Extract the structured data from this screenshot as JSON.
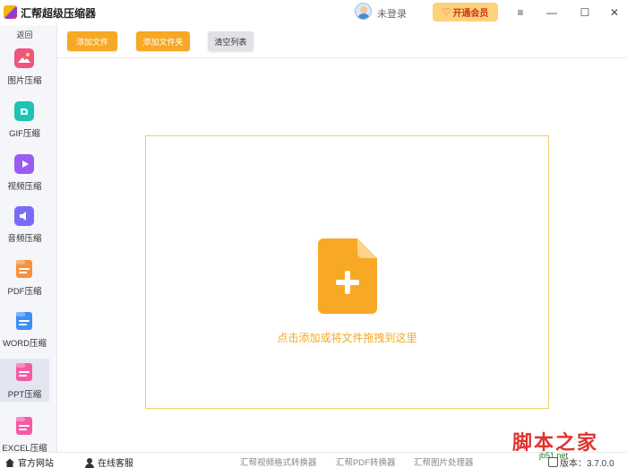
{
  "titlebar": {
    "app_title": "汇帮超级压缩器",
    "login_label": "未登录",
    "vip_label": "开通会员",
    "controls": {
      "menu": "≡",
      "minimize": "—",
      "maximize": "☐",
      "close": "✕"
    }
  },
  "sidebar": {
    "back_label": "返回",
    "items": [
      {
        "label": "图片压缩",
        "icon": "image-icon",
        "color": "#f0557c"
      },
      {
        "label": "GIF压缩",
        "icon": "gif-icon",
        "color": "#1fc3b3"
      },
      {
        "label": "视频压缩",
        "icon": "video-play-icon",
        "color": "#9a5cf2"
      },
      {
        "label": "音频压缩",
        "icon": "audio-icon",
        "color": "#7b6cf6"
      },
      {
        "label": "PDF压缩",
        "icon": "pdf-file-icon",
        "color": "#f7923a"
      },
      {
        "label": "WORD压缩",
        "icon": "word-file-icon",
        "color": "#3d8ef5"
      },
      {
        "label": "PPT压缩",
        "icon": "ppt-file-icon",
        "color": "#f55aa3",
        "active": true
      },
      {
        "label": "EXCEL压缩",
        "icon": "excel-file-icon",
        "color": "#f55aa3"
      }
    ]
  },
  "toolbar": {
    "add_file": "添加文件",
    "add_folder": "添加文件夹",
    "clear_list": "清空列表"
  },
  "dropzone": {
    "hint": "点击添加或将文件拖拽到这里",
    "accent": "#f7a824"
  },
  "bottombar": {
    "official_site": "官方网站",
    "online_service": "在线客服",
    "links": [
      "汇帮视频格式转换器",
      "汇帮PDF转换器",
      "汇帮图片处理器"
    ],
    "version": "版本：3.7.0.0"
  },
  "watermark": {
    "title": "脚本之家",
    "url": "jb51.net"
  }
}
